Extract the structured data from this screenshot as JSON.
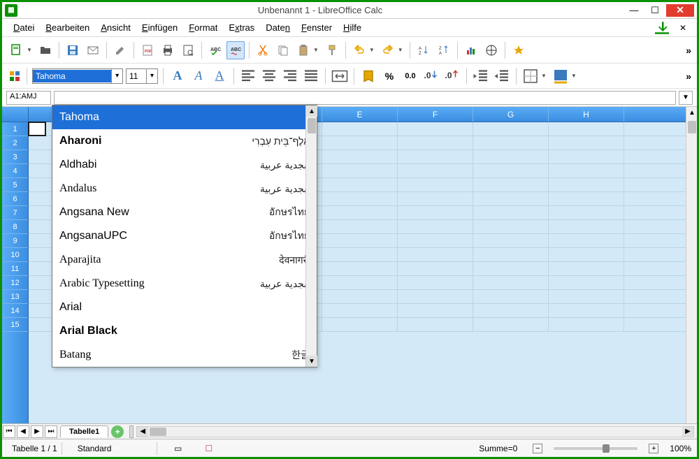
{
  "window": {
    "title": "Unbenannt 1 - LibreOffice Calc"
  },
  "menu": {
    "items": [
      "Datei",
      "Bearbeiten",
      "Ansicht",
      "Einfügen",
      "Format",
      "Extras",
      "Daten",
      "Fenster",
      "Hilfe"
    ]
  },
  "format": {
    "font_name": "Tahoma",
    "font_size": "11"
  },
  "refbar": {
    "name_box": "A1:AMJ"
  },
  "columns": [
    "E",
    "F",
    "G",
    "H"
  ],
  "rows": [
    "1",
    "2",
    "3",
    "4",
    "5",
    "6",
    "7",
    "8",
    "9",
    "10",
    "11",
    "12",
    "13",
    "14",
    "15"
  ],
  "font_list": [
    {
      "name": "Tahoma",
      "sample": "",
      "selected": true,
      "style": ""
    },
    {
      "name": "Aharoni",
      "sample": "אָלֶף־בֵּית עִבְרִי",
      "selected": false,
      "style": "bold"
    },
    {
      "name": "Aldhabi",
      "sample": "أبجدية عربية",
      "selected": false,
      "style": ""
    },
    {
      "name": "Andalus",
      "sample": "أبجدية عربية",
      "selected": false,
      "style": "serif"
    },
    {
      "name": "Angsana New",
      "sample": "อักษรไทย",
      "selected": false,
      "style": ""
    },
    {
      "name": "AngsanaUPC",
      "sample": "อักษรไทย",
      "selected": false,
      "style": ""
    },
    {
      "name": "Aparajita",
      "sample": "देवनागरी",
      "selected": false,
      "style": "serif"
    },
    {
      "name": "Arabic Typesetting",
      "sample": "أبجدية عربية",
      "selected": false,
      "style": "serif"
    },
    {
      "name": "Arial",
      "sample": "",
      "selected": false,
      "style": ""
    },
    {
      "name": "Arial Black",
      "sample": "",
      "selected": false,
      "style": "bold"
    },
    {
      "name": "Batang",
      "sample": "한글",
      "selected": false,
      "style": "serif"
    }
  ],
  "tabs": {
    "active": "Tabelle1"
  },
  "status": {
    "sheet": "Tabelle 1 / 1",
    "style": "Standard",
    "sum": "Summe=0",
    "zoom": "100%"
  }
}
